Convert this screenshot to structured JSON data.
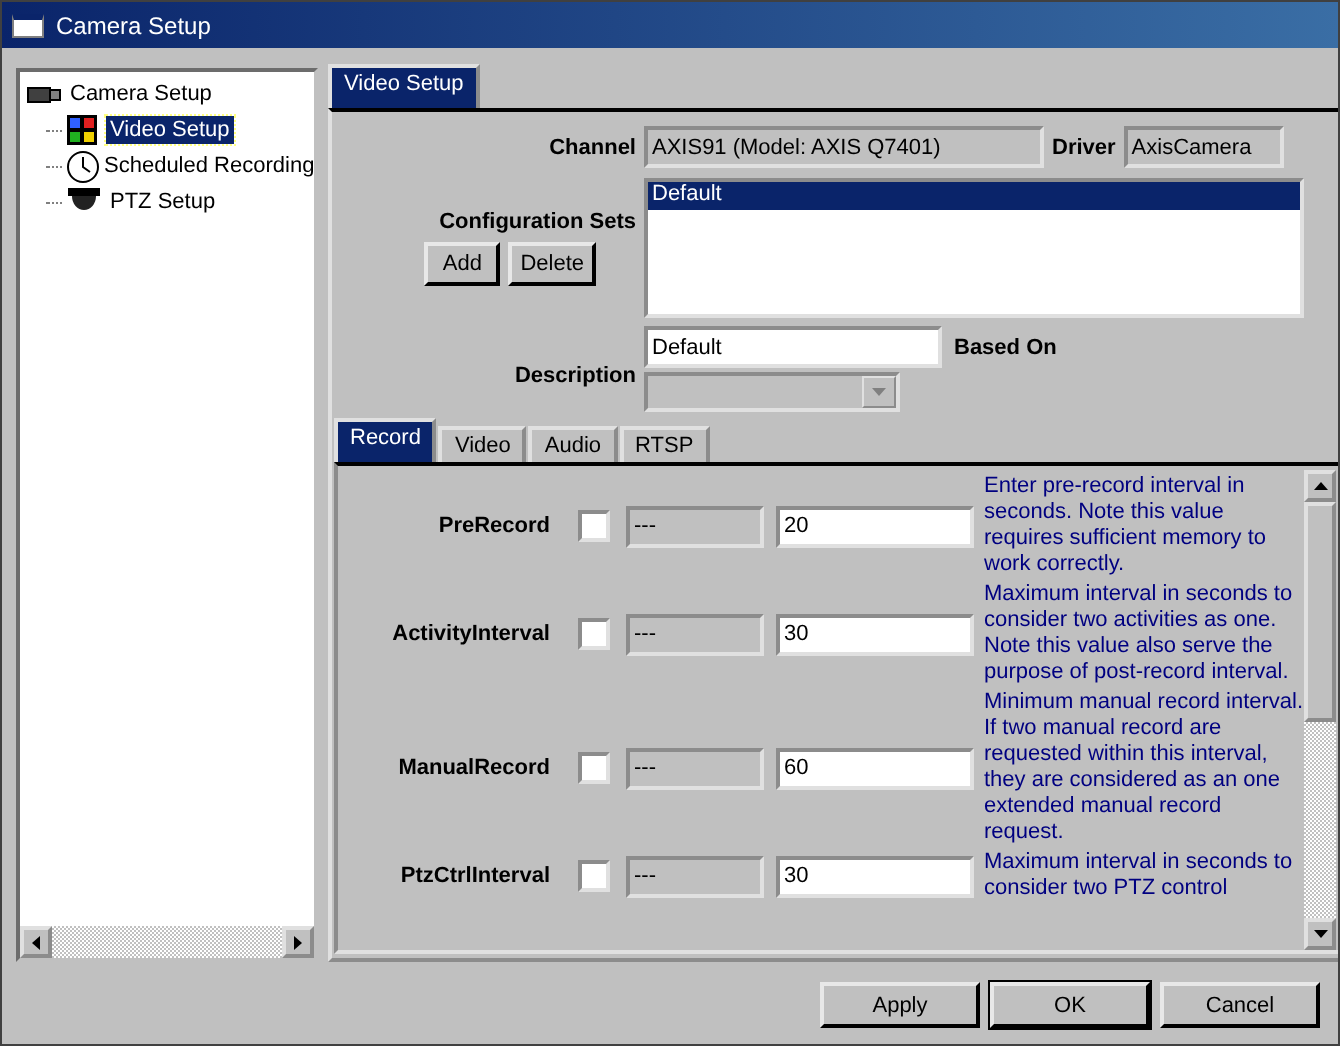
{
  "window": {
    "title": "Camera Setup"
  },
  "tree": [
    {
      "label": "Camera Setup",
      "kind": "camera",
      "selected": false,
      "children": [
        {
          "label": "Video Setup",
          "kind": "video",
          "selected": true
        },
        {
          "label": "Scheduled Recording",
          "kind": "schedule",
          "selected": false
        },
        {
          "label": "PTZ Setup",
          "kind": "ptz",
          "selected": false
        }
      ]
    }
  ],
  "top_tabs": [
    {
      "label": "Video Setup",
      "selected": true
    }
  ],
  "channel": {
    "label": "Channel",
    "value": "AXIS91 (Model: AXIS Q7401)"
  },
  "driver": {
    "label": "Driver",
    "value": "AxisCamera"
  },
  "configuration_sets": {
    "label": "Configuration Sets",
    "buttons": [
      "Add",
      "Delete"
    ],
    "items": [
      {
        "label": "Default",
        "selected": true
      }
    ]
  },
  "description": {
    "label": "Description",
    "value": "Default"
  },
  "based_on": {
    "label": "Based On"
  },
  "sub_tabs": [
    {
      "label": "Record",
      "selected": true
    },
    {
      "label": "Video",
      "selected": false
    },
    {
      "label": "Audio",
      "selected": false
    },
    {
      "label": "RTSP",
      "selected": false
    }
  ],
  "settings": [
    {
      "name": "PreRecord",
      "checked": false,
      "default": "---",
      "value": "20",
      "help": "Enter pre-record interval in seconds. Note this value requires sufficient memory to work correctly."
    },
    {
      "name": "ActivityInterval",
      "checked": false,
      "default": "---",
      "value": "30",
      "help": "Maximum interval in seconds to consider two activities as one. Note this value also serve the purpose of post-record interval."
    },
    {
      "name": "ManualRecord",
      "checked": false,
      "default": "---",
      "value": "60",
      "help": "Minimum manual record interval. If two manual record are requested within this interval, they are considered as an one extended manual record request."
    },
    {
      "name": "PtzCtrlInterval",
      "checked": false,
      "default": "---",
      "value": "30",
      "help": "Maximum interval in seconds to consider two PTZ control"
    }
  ],
  "buttons": [
    "Apply",
    "OK",
    "Cancel"
  ]
}
